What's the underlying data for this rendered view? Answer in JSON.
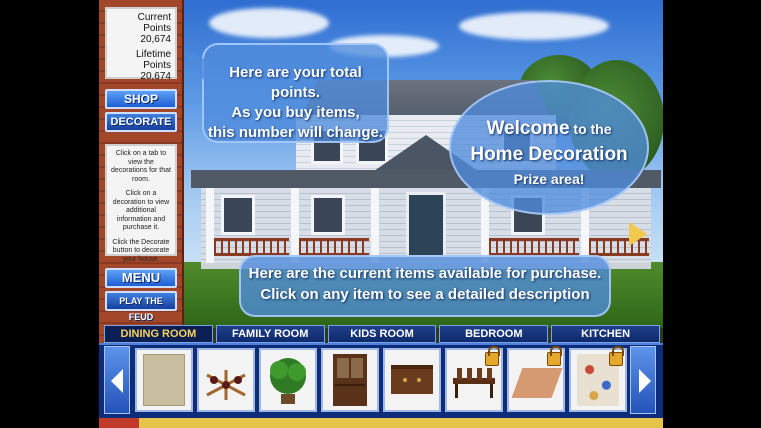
{
  "points": {
    "current_label": "Current Points",
    "current_value": "20,674",
    "lifetime_label": "Lifetime Points",
    "lifetime_value": "20,674"
  },
  "buttons": {
    "shop": "SHOP",
    "decorate": "DECORATE",
    "menu": "MENU",
    "play_feud": "PLAY THE FEUD"
  },
  "help": {
    "p1": "Click on a tab to view the decorations for that room.",
    "p2": "Click on a decoration to view additional information and purchase it.",
    "p3": "Click the Decorate button to decorate your house."
  },
  "bubbles": {
    "points_line1": "Here are your total points.",
    "points_line2": "As you buy items,",
    "points_line3": "this number will change.",
    "welcome_word": "Welcome",
    "welcome_to": " to the",
    "welcome_line2": "Home Decoration",
    "welcome_line3": "Prize area!",
    "items_line1": "Here are the current items available for purchase.",
    "items_line2": "Click on any item to see a detailed description"
  },
  "tabs": [
    {
      "label": "DINING ROOM",
      "active": true
    },
    {
      "label": "FAMILY ROOM",
      "active": false
    },
    {
      "label": "KIDS ROOM",
      "active": false
    },
    {
      "label": "BEDROOM",
      "active": false
    },
    {
      "label": "KITCHEN",
      "active": false
    }
  ],
  "items": [
    {
      "name": "rug-beige",
      "locked": false
    },
    {
      "name": "wine-rack",
      "locked": false
    },
    {
      "name": "potted-plant",
      "locked": false
    },
    {
      "name": "china-cabinet",
      "locked": false
    },
    {
      "name": "sideboard",
      "locked": false
    },
    {
      "name": "dining-table-set",
      "locked": true
    },
    {
      "name": "floor-mat",
      "locked": true
    },
    {
      "name": "patterned-rug",
      "locked": true
    }
  ],
  "colors": {
    "accent": "#1d5ed6",
    "tab_active_text": "#f6d35b",
    "brick": "#a3472a"
  }
}
